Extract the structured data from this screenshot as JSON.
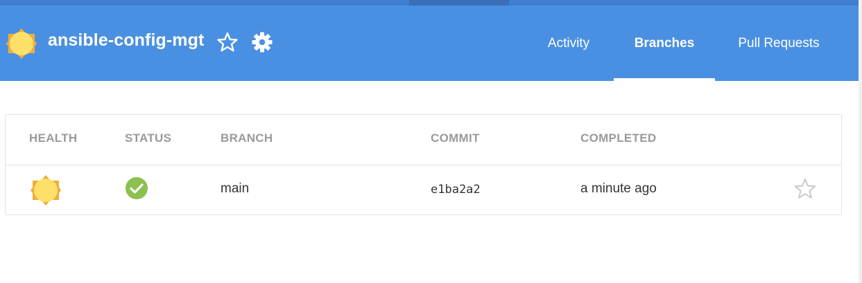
{
  "header": {
    "repo_name": "ansible-config-mgt",
    "tabs": [
      {
        "label": "Activity",
        "active": false
      },
      {
        "label": "Branches",
        "active": true
      },
      {
        "label": "Pull Requests",
        "active": false
      }
    ]
  },
  "table": {
    "columns": [
      "HEALTH",
      "STATUS",
      "BRANCH",
      "COMMIT",
      "COMPLETED"
    ],
    "rows": [
      {
        "health_icon": "sun-icon",
        "status_icon": "check-circle-icon",
        "branch": "main",
        "commit": "e1ba2a2",
        "completed": "a minute ago",
        "favorite": false
      }
    ]
  },
  "colors": {
    "header_bg": "#4a90e2",
    "sun_fill": "#fde06a",
    "sun_rays": "#f0ad3a",
    "success": "#8cc04f",
    "column_header": "#9a9a9a"
  }
}
